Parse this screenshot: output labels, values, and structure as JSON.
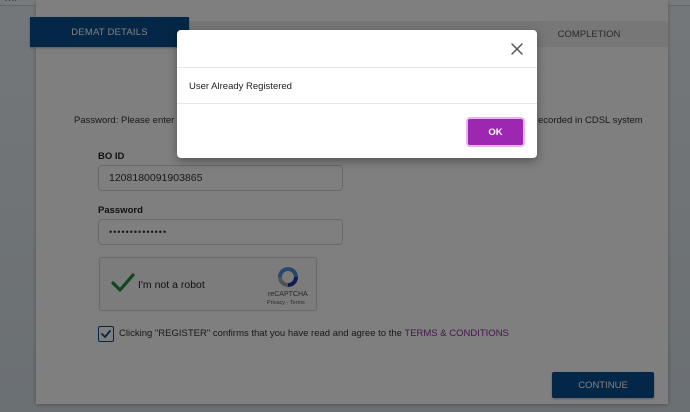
{
  "browser": {
    "url_fragment": "…/"
  },
  "steps": {
    "active": "DEMAT DETAILS",
    "last": "COMPLETION"
  },
  "instructions": {
    "left": "Password: Please enter you",
    "right": "ecorded in CDSL system"
  },
  "form": {
    "boid_label": "BO ID",
    "boid_value": "1208180091903865",
    "password_label": "Password",
    "password_value": "••••••••••••••"
  },
  "recaptcha": {
    "label": "I'm not a robot",
    "brand": "reCAPTCHA",
    "links": "Privacy - Terms",
    "checked": true
  },
  "terms": {
    "prefix": "Clicking \"REGISTER\" confirms that you have read and agree to the ",
    "link": "TERMS & CONDITIONS",
    "checked": true
  },
  "continue_label": "CONTINUE",
  "modal": {
    "message": "User Already Registered",
    "ok_label": "OK"
  },
  "colors": {
    "primary": "#0b4f8f",
    "accent": "#9c27b0",
    "link": "#8e2a9c",
    "check": "#1e8e3e"
  },
  "icons": {
    "close": "close-icon",
    "recaptcha_check": "checkmark-icon",
    "recaptcha_logo": "recaptcha-logo-icon",
    "terms_check": "checkbox-checked-icon"
  }
}
